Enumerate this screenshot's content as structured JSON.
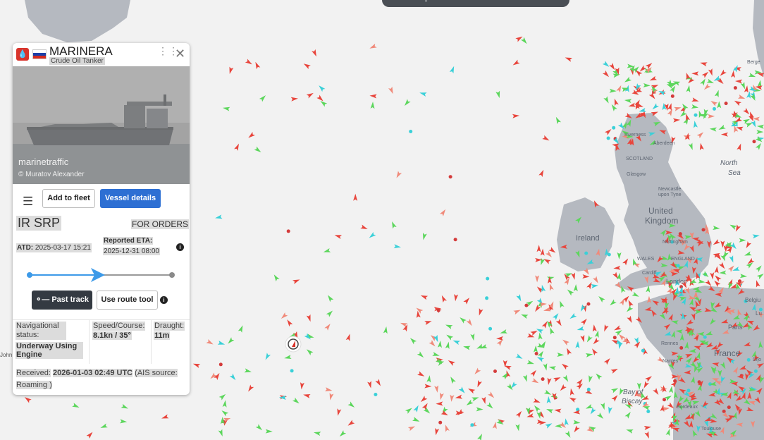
{
  "vessel": {
    "name": "MARINERA",
    "type": "Crude Oil Tanker",
    "flag_country": "Russia",
    "photo_watermark": "marinetraffic",
    "photo_credit": "© Muratov Alexander",
    "destination": "IR SRP",
    "destination_status": "FOR ORDERS",
    "atd_label": "ATD:",
    "atd_value": "2025-03-17 15:21",
    "eta_label": "Reported ETA:",
    "eta_value": "2025-12-31 08:00",
    "voyage_progress": 0.48,
    "nav_status_label": "Navigational status:",
    "nav_status_value": "Underway Using Engine",
    "speed_label": "Speed/Course:",
    "speed_value": "8.1kn / 35°",
    "draught_label": "Draught:",
    "draught_value": "11m",
    "received_prefix": "Received:",
    "received_time": "2026-01-03 02:49 UTC",
    "received_source": "(AIS source: Roaming )"
  },
  "buttons": {
    "add_to_fleet": "Add to fleet",
    "vessel_details": "Vessel details",
    "past_track": "Past track",
    "use_route_tool": "Use route tool"
  },
  "icons": {
    "menu": "menu-icon",
    "drag": "drag-handle-icon",
    "close": "close-icon",
    "info": "info-icon",
    "tanker": "tanker-icon",
    "search": "search-icon"
  },
  "colors": {
    "primary": "#2d6fd3",
    "dark_button": "#343a42",
    "progress": "#3d9ae8",
    "tanker_red": "#d9342b",
    "land": "#b5b9c0",
    "sea": "#f2f2f2"
  },
  "map_labels": {
    "ireland": "Ireland",
    "uk_line1": "United",
    "uk_line2": "Kingdom",
    "france": "France",
    "london": "London",
    "paris": "Paris",
    "scotland": "SCOTLAND",
    "wales": "WALES",
    "england": "ENGLAND",
    "aberdeen": "Aberdeen",
    "glasgow": "Glasgow",
    "newcastle_line1": "Newcastle",
    "newcastle_line2": "upon Tyne",
    "nottingham": "Nottingham",
    "cardiff": "Cardiff",
    "rennes": "Rennes",
    "nantes": "Nantes",
    "bordeaux": "Bordeaux",
    "toulouse": "Toulouse",
    "inverness": "Inverness",
    "bay_line1": "Bay of",
    "bay_line2": "Biscay",
    "north_line1": "North",
    "north_line2": "Sea",
    "john": "John",
    "bergen_partial": "Berge",
    "belgium_partial": "Belgiu",
    "dijon_partial": "Dijo",
    "lux_partial": "Lu"
  }
}
